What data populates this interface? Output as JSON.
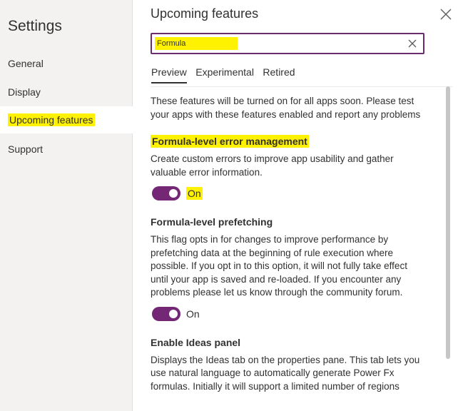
{
  "sidebar": {
    "title": "Settings",
    "items": [
      {
        "label": "General",
        "active": false
      },
      {
        "label": "Display",
        "active": false
      },
      {
        "label": "Upcoming features",
        "active": true
      },
      {
        "label": "Support",
        "active": false
      }
    ]
  },
  "panel": {
    "title": "Upcoming features",
    "search": {
      "value": "Formula"
    },
    "tabs": [
      {
        "label": "Preview",
        "active": true
      },
      {
        "label": "Experimental",
        "active": false
      },
      {
        "label": "Retired",
        "active": false
      }
    ],
    "intro": "These features will be turned on for all apps soon. Please test your apps with these features enabled and report any problems",
    "features": [
      {
        "title": "Formula-level error management",
        "description": "Create custom errors to improve app usability and gather valuable error information.",
        "toggle_label": "On",
        "enabled": true
      },
      {
        "title": "Formula-level prefetching",
        "description": "This flag opts in for changes to improve performance by prefetching data at the beginning of rule execution where possible. If you opt in to this option, it will not fully take effect until your app is saved and re-loaded. If you encounter any problems please let us know through the community forum.",
        "toggle_label": "On",
        "enabled": true
      },
      {
        "title": "Enable Ideas panel",
        "description": "Displays the Ideas tab on the properties pane. This tab lets you use natural language to automatically generate Power Fx formulas. Initially it will support a limited number of regions"
      }
    ]
  },
  "colors": {
    "accent": "#742774",
    "highlight": "#fff200",
    "sidebar_bg": "#f3f2f1"
  },
  "icons": [
    "close-icon",
    "clear-search-icon"
  ]
}
